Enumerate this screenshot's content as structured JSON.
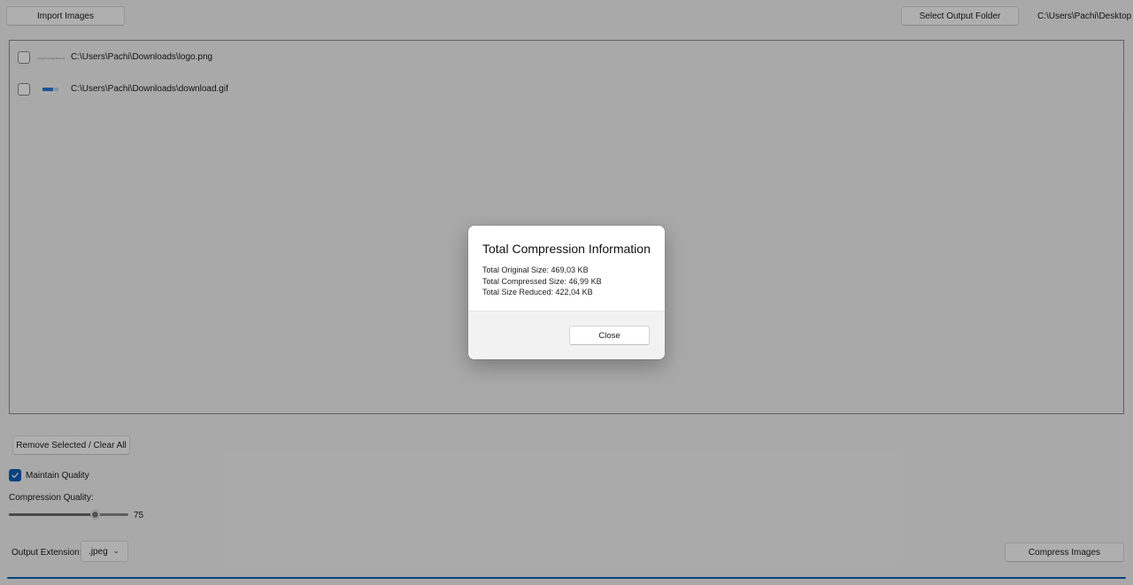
{
  "toolbar": {
    "import_label": "Import Images",
    "select_output_label": "Select Output Folder",
    "output_path": "C:\\Users\\Pachi\\Desktop"
  },
  "files": [
    {
      "path": "C:\\Users\\Pachi\\Downloads\\logo.png",
      "thumb_text": "ImgCompressor",
      "checked": false
    },
    {
      "path": "C:\\Users\\Pachi\\Downloads\\download.gif",
      "checked": false
    }
  ],
  "controls": {
    "remove_label": "Remove Selected / Clear All",
    "maintain_quality_label": "Maintain Quality",
    "maintain_quality_checked": true,
    "compression_quality_label": "Compression Quality:",
    "quality_value": "75",
    "quality_fraction": 0.72,
    "output_extension_label": "Output Extension:",
    "output_extension_value": ".jpeg",
    "compress_label": "Compress Images",
    "progress_fraction": 1.0
  },
  "dialog": {
    "title": "Total Compression Information",
    "original_size": "Total Original Size: 469,03 KB",
    "compressed_size": "Total Compressed Size: 46,99 KB",
    "size_reduced": "Total Size Reduced: 422,04 KB",
    "close_label": "Close"
  },
  "colors": {
    "accent": "#0a5fb4",
    "overlay": "rgba(0,0,0,0.3)"
  }
}
